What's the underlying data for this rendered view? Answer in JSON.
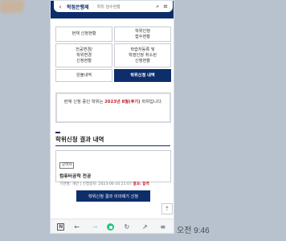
{
  "app": {
    "logo": "학점은행제",
    "logo_sub": "학위 검수현황"
  },
  "menu": [
    {
      "label": "현재 신청현황",
      "active": false
    },
    {
      "label": "학위인정\n접수현황",
      "active": false
    },
    {
      "label": "전공변경/\n학위변경\n신청현황",
      "active": false
    },
    {
      "label": "학습자등록 및\n학점인정 취소된\n신청현황",
      "active": false
    },
    {
      "label": "완불내역",
      "active": false
    },
    {
      "label": "학위신청 내역",
      "active": true
    }
  ],
  "notice": {
    "prefix": "현재 신청 중인 학위는 ",
    "highlight": "2023년 8월(후기)",
    "suffix": " 학위입니다."
  },
  "section": {
    "title": "학위신청 결과 내역"
  },
  "result": {
    "badge": "공학사",
    "name": "컴퓨터공학 전공",
    "meta": "기관명: 개인 | 신청일자: 2023-06-16 21:07",
    "status_label": "결과: 합격"
  },
  "buttons": {
    "cancel": "학위신청 결과 이의제기 신청",
    "scroll_top": "⇡"
  },
  "nav": {
    "n_label": "N",
    "back": "←",
    "forward": "→",
    "refresh": "↻",
    "share": "↗",
    "menu": "≡"
  },
  "chat": {
    "timestamp": "오전 9:46"
  },
  "colors": {
    "navy": "#0d2d6b",
    "highlight_red": "#c21d2a",
    "home_green": "#20c77a",
    "chat_background": "#b8c2cf"
  }
}
